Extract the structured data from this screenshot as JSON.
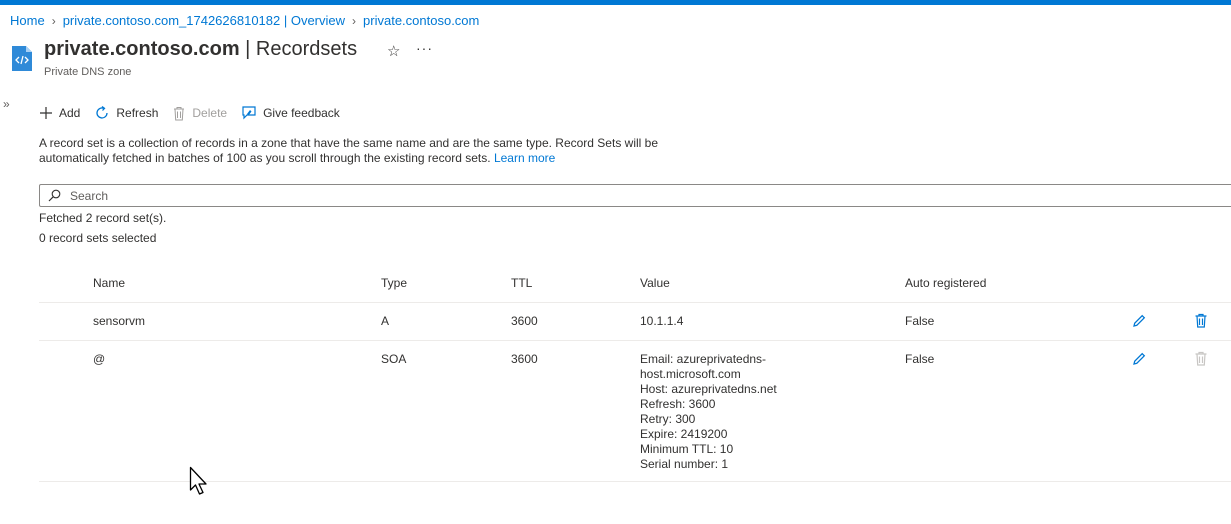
{
  "breadcrumb": {
    "items": [
      "Home",
      "private.contoso.com_1742626810182 | Overview",
      "private.contoso.com"
    ]
  },
  "header": {
    "title_bold": "private.contoso.com",
    "title_rest": " | Recordsets",
    "subtitle": "Private DNS zone"
  },
  "toolbar": {
    "add_label": "Add",
    "refresh_label": "Refresh",
    "delete_label": "Delete",
    "feedback_label": "Give feedback"
  },
  "description": {
    "text": "A record set is a collection of records in a zone that have the same name and are the same type. Record Sets will be automatically fetched in batches of 100 as you scroll through the existing record sets.",
    "link": "Learn more"
  },
  "search": {
    "placeholder": "Search",
    "value": ""
  },
  "status": {
    "fetched": "Fetched 2 record set(s).",
    "selected": "0 record sets selected"
  },
  "table": {
    "columns": [
      "Name",
      "Type",
      "TTL",
      "Value",
      "Auto registered"
    ],
    "rows": [
      {
        "name": "sensorvm",
        "type": "A",
        "ttl": "3600",
        "value": [
          "10.1.1.4"
        ],
        "auto": "False",
        "delete_enabled": true
      },
      {
        "name": "@",
        "type": "SOA",
        "ttl": "3600",
        "value": [
          "Email: azureprivatedns-",
          "host.microsoft.com",
          "Host: azureprivatedns.net",
          "Refresh: 3600",
          "Retry: 300",
          "Expire: 2419200",
          "Minimum TTL: 10",
          "Serial number: 1"
        ],
        "auto": "False",
        "delete_enabled": false
      }
    ]
  },
  "colors": {
    "accent": "#0078d4",
    "text": "#323130",
    "disabled": "#a19f9d"
  }
}
